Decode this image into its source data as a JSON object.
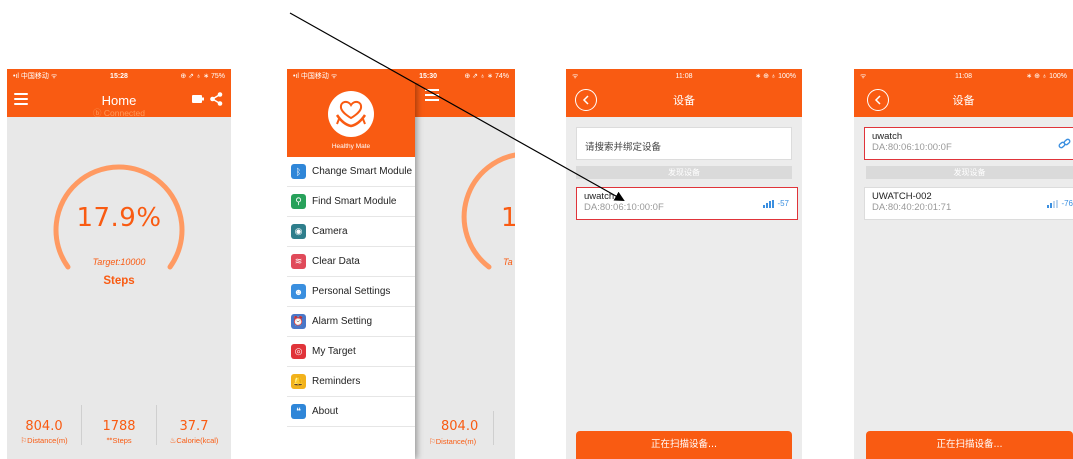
{
  "colors": {
    "accent": "#f95b12",
    "gauge_track": "#ff9a62",
    "selected_border": "#e0343a",
    "signal": "#3b8fe0"
  },
  "home": {
    "status": {
      "left": "•ıl 中国移动 ᯤ",
      "time": "15:28",
      "right": "⊕ ⇗ ♁ ∗ 75%"
    },
    "title": "Home",
    "connected": "Connected",
    "percent": "17.9%",
    "target": "Target:10000",
    "steps_label": "Steps",
    "stats": [
      {
        "value": "804.0",
        "label": "Distance(m)"
      },
      {
        "value": "1788",
        "label": "Steps"
      },
      {
        "value": "37.7",
        "label": "Calorie(kcal)"
      }
    ]
  },
  "menu": {
    "status": {
      "left": "•ıl 中国移动 ᯤ",
      "time": "15:30",
      "right": "⊕ ⇗ ♁ ∗ 74%"
    },
    "brand": "Healthy Mate",
    "items": [
      {
        "label": "Change Smart Module",
        "icon": "bluetooth-icon",
        "color": "#2f86d8",
        "glyph": "ᛒ"
      },
      {
        "label": "Find Smart Module",
        "icon": "find-icon",
        "color": "#27a15a",
        "glyph": "⚲"
      },
      {
        "label": "Camera",
        "icon": "camera-icon",
        "color": "#2e7e8c",
        "glyph": "◉"
      },
      {
        "label": "Clear Data",
        "icon": "clear-data-icon",
        "color": "#e04a5a",
        "glyph": "≋"
      },
      {
        "label": "Personal Settings",
        "icon": "person-icon",
        "color": "#3a8fdf",
        "glyph": "☻"
      },
      {
        "label": "Alarm Setting",
        "icon": "alarm-icon",
        "color": "#4a77c8",
        "glyph": "⏰"
      },
      {
        "label": "My Target",
        "icon": "target-icon",
        "color": "#e0343a",
        "glyph": "◎"
      },
      {
        "label": "Reminders",
        "icon": "bell-icon",
        "color": "#f2b21c",
        "glyph": "🔔"
      },
      {
        "label": "About",
        "icon": "quote-icon",
        "color": "#2f86d8",
        "glyph": "❝"
      }
    ],
    "underlay_value": "804.0",
    "underlay_label": "Distance(m)",
    "underlay_percent": "1",
    "underlay_target": "Ta"
  },
  "devices1": {
    "status": {
      "left": "ᯤ",
      "time": "11:08",
      "right": "∗ ⊕ ♁ 100%"
    },
    "title": "设备",
    "search_prompt": "请搜索并绑定设备",
    "found_label": "发现设备",
    "device": {
      "name": "uwatch",
      "mac": "DA:80:06:10:00:0F",
      "rssi": "-57"
    },
    "scan_button": "正在扫描设备..."
  },
  "devices2": {
    "status": {
      "left": "ᯤ",
      "time": "11:08",
      "right": "∗ ⊕ ♁ 100%"
    },
    "title": "设备",
    "bound_device": {
      "name": "uwatch",
      "mac": "DA:80:06:10:00:0F"
    },
    "found_label": "发现设备",
    "device": {
      "name": "UWATCH-002",
      "mac": "DA:80:40:20:01:71",
      "rssi": "-76"
    },
    "scan_button": "正在扫描设备..."
  }
}
